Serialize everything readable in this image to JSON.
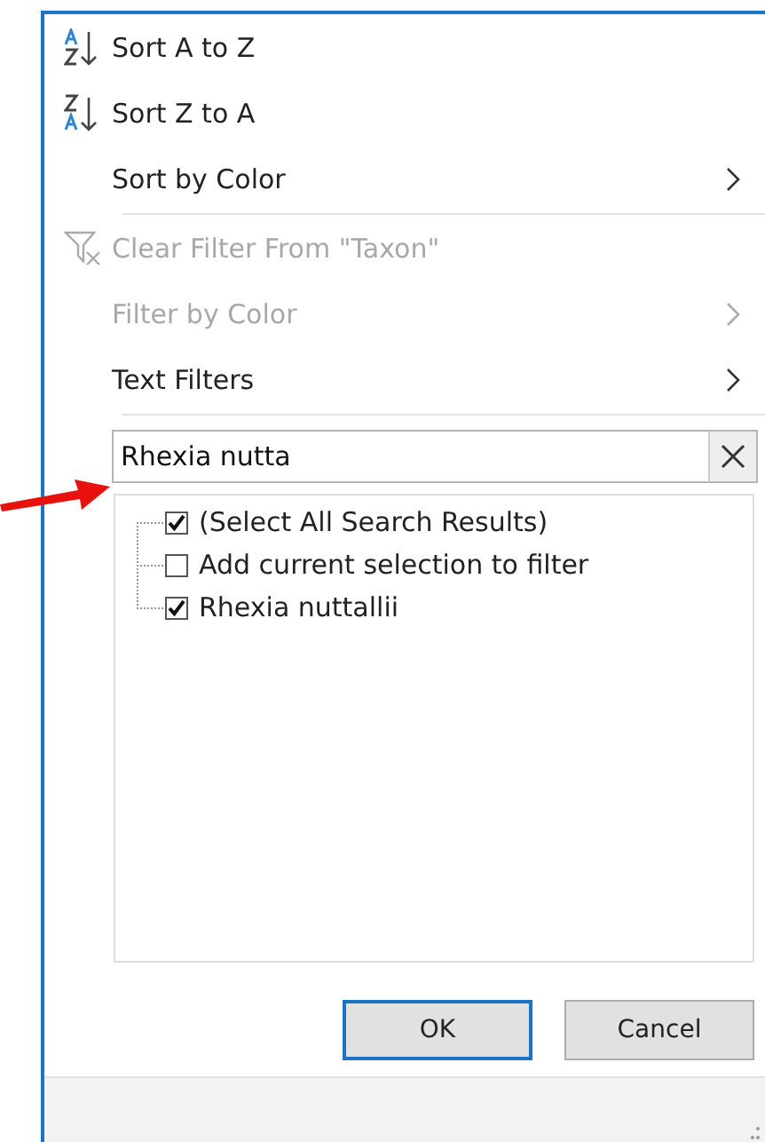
{
  "menu_items": [
    {
      "kind": "sort_asc",
      "label": "Sort A to Z",
      "disabled": false,
      "submenu": false,
      "separator_after": false
    },
    {
      "kind": "sort_desc",
      "label": "Sort Z to A",
      "disabled": false,
      "submenu": false,
      "separator_after": false
    },
    {
      "kind": "plain",
      "label": "Sort by Color",
      "disabled": false,
      "submenu": true,
      "separator_after": true
    },
    {
      "kind": "clear_filter",
      "label": "Clear Filter From \"Taxon\"",
      "disabled": true,
      "submenu": false,
      "separator_after": false
    },
    {
      "kind": "plain",
      "label": "Filter by Color",
      "disabled": true,
      "submenu": true,
      "separator_after": false
    },
    {
      "kind": "plain",
      "label": "Text Filters",
      "disabled": false,
      "submenu": true,
      "separator_after": true
    }
  ],
  "search": {
    "value": "Rhexia nutta"
  },
  "filter_list": [
    {
      "label": "(Select All Search Results)",
      "checked": true
    },
    {
      "label": "Add current selection to filter",
      "checked": false
    },
    {
      "label": "Rhexia nuttallii",
      "checked": true
    }
  ],
  "buttons": [
    {
      "label": "OK",
      "default": true
    },
    {
      "label": "Cancel",
      "default": false
    }
  ]
}
